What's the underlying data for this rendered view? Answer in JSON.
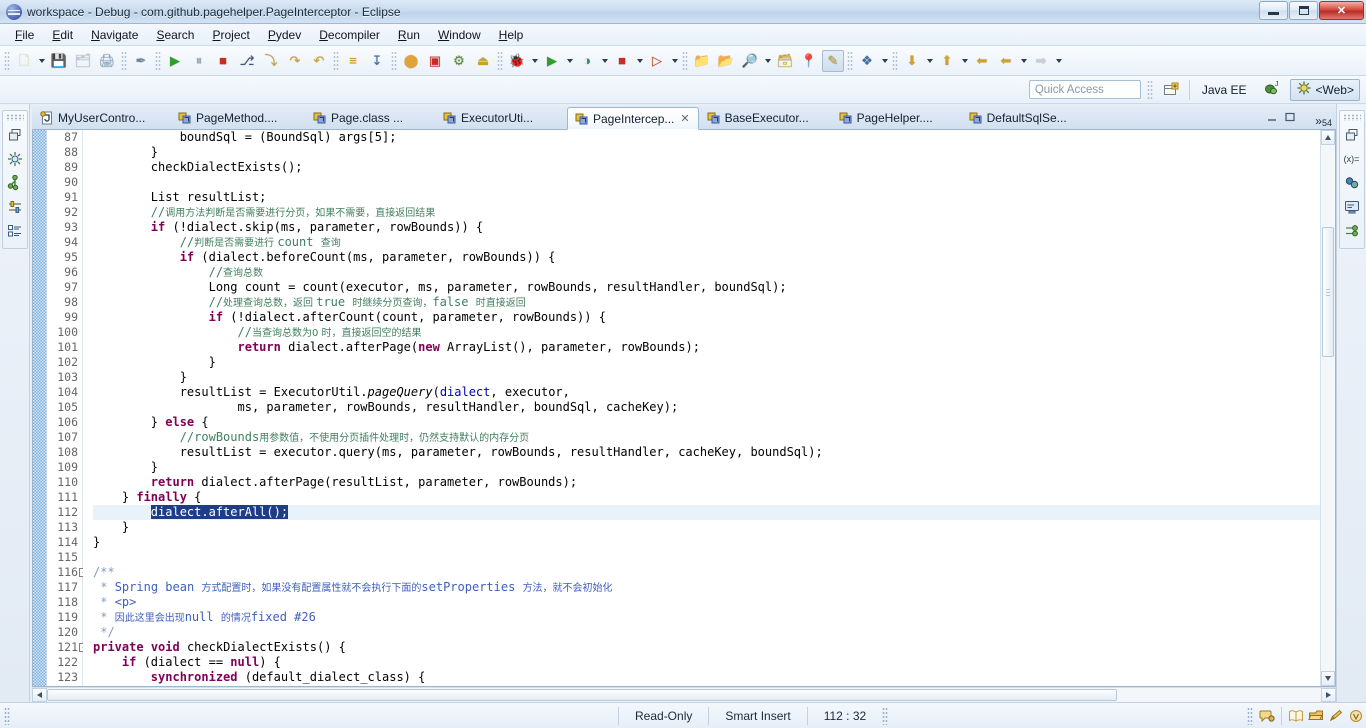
{
  "window": {
    "title": "workspace - Debug - com.github.pagehelper.PageInterceptor - Eclipse",
    "app_icon": "eclipse-icon",
    "minimize_label": "–",
    "maximize_label": "❐",
    "close_label": "✕"
  },
  "menu": {
    "items": [
      {
        "label": "File"
      },
      {
        "label": "Edit"
      },
      {
        "label": "Navigate"
      },
      {
        "label": "Search"
      },
      {
        "label": "Project"
      },
      {
        "label": "Pydev"
      },
      {
        "label": "Decompiler"
      },
      {
        "label": "Run"
      },
      {
        "label": "Window"
      },
      {
        "label": "Help"
      }
    ]
  },
  "toolbar": {
    "groups": [
      {
        "buttons": [
          {
            "name": "new-wizard-icon",
            "glyph": "🗋",
            "dropdown": true,
            "color": "#f5e9a0"
          },
          {
            "name": "save-icon",
            "glyph": "💾",
            "dropdown": false,
            "color": "#b9c7d6"
          },
          {
            "name": "save-all-icon",
            "glyph": "🗂",
            "dropdown": false,
            "color": "#b9c7d6"
          },
          {
            "name": "print-icon",
            "glyph": "🖨",
            "dropdown": false,
            "color": "#7f9fc0"
          }
        ]
      },
      {
        "buttons": [
          {
            "name": "toggle-mark-occurrences-icon",
            "glyph": "✒",
            "dropdown": false,
            "color": "#6f8296"
          }
        ]
      },
      {
        "buttons": [
          {
            "name": "resume-icon",
            "glyph": "▶",
            "dropdown": false,
            "color": "#2f9e2f"
          },
          {
            "name": "suspend-icon",
            "glyph": "⏸",
            "dropdown": false,
            "color": "#9aa8b6"
          },
          {
            "name": "terminate-icon",
            "glyph": "■",
            "dropdown": false,
            "color": "#cc2a22"
          },
          {
            "name": "disconnect-icon",
            "glyph": "⎇",
            "dropdown": false,
            "color": "#3a5a80"
          },
          {
            "name": "step-into-icon",
            "glyph": "⤵",
            "dropdown": false,
            "color": "#c9a227"
          },
          {
            "name": "step-over-icon",
            "glyph": "↷",
            "dropdown": false,
            "color": "#d1a12a"
          },
          {
            "name": "step-return-icon",
            "glyph": "↶",
            "dropdown": false,
            "color": "#d1a12a"
          }
        ]
      },
      {
        "buttons": [
          {
            "name": "run-to-line-icon",
            "glyph": "≡",
            "dropdown": false,
            "color": "#c9a227"
          },
          {
            "name": "drop-to-frame-icon",
            "glyph": "↧",
            "dropdown": false,
            "color": "#3a6ea5"
          }
        ]
      },
      {
        "buttons": [
          {
            "name": "new-java-class-icon",
            "glyph": "⬤",
            "dropdown": false,
            "color": "#e0a33a"
          },
          {
            "name": "new-annotation-icon",
            "glyph": "▣",
            "dropdown": false,
            "color": "#cc2a22"
          },
          {
            "name": "new-package-icon",
            "glyph": "⚙",
            "dropdown": false,
            "color": "#5f8a3f"
          },
          {
            "name": "open-type-icon",
            "glyph": "⏏",
            "dropdown": false,
            "color": "#c9a227"
          }
        ]
      },
      {
        "buttons": [
          {
            "name": "debug-launch-icon",
            "glyph": "🐞",
            "dropdown": true,
            "color": "#5f8a3f"
          },
          {
            "name": "run-launch-icon",
            "glyph": "▶",
            "dropdown": true,
            "color": "#2f9e2f"
          },
          {
            "name": "coverage-icon",
            "glyph": "◑",
            "dropdown": true,
            "color": "#3a8a5f"
          },
          {
            "name": "stop-icon",
            "glyph": "■",
            "dropdown": true,
            "color": "#cc2a22"
          },
          {
            "name": "run-external-tools-icon",
            "glyph": "▷",
            "dropdown": true,
            "color": "#c9522a"
          }
        ]
      },
      {
        "buttons": [
          {
            "name": "new-package-explorer-icon",
            "glyph": "📁",
            "dropdown": false,
            "color": "#e0b352"
          },
          {
            "name": "open-folder-icon",
            "glyph": "📂",
            "dropdown": false,
            "color": "#e0b352"
          },
          {
            "name": "search-icon",
            "glyph": "🔎",
            "dropdown": true,
            "color": "#d1a12a"
          },
          {
            "name": "open-task-icon",
            "glyph": "🗃",
            "dropdown": false,
            "color": "#d1a12a"
          },
          {
            "name": "pin-icon",
            "glyph": "📍",
            "dropdown": false,
            "color": "#3a8a5f"
          },
          {
            "name": "pen-highlight-icon",
            "glyph": "✎",
            "dropdown": false,
            "color": "#c9a227",
            "pressed": true
          }
        ]
      },
      {
        "buttons": [
          {
            "name": "refactor-icon",
            "glyph": "❖",
            "dropdown": true,
            "color": "#3a6ea5"
          }
        ]
      },
      {
        "buttons": [
          {
            "name": "next-annotation-icon",
            "glyph": "⬇",
            "dropdown": true,
            "color": "#d1a12a"
          },
          {
            "name": "previous-annotation-icon",
            "glyph": "⬆",
            "dropdown": true,
            "color": "#d1a12a"
          },
          {
            "name": "last-edit-location-icon",
            "glyph": "⬅",
            "dropdown": false,
            "color": "#d1a12a"
          },
          {
            "name": "back-icon",
            "glyph": "⬅",
            "dropdown": true,
            "color": "#d1a12a"
          },
          {
            "name": "forward-icon",
            "glyph": "➡",
            "dropdown": true,
            "color": "#c5cfd9"
          }
        ]
      }
    ]
  },
  "perspective_bar": {
    "quick_access_placeholder": "Quick Access",
    "open_perspective_icon": "open-perspective-icon",
    "perspectives": [
      {
        "name": "java-ee-perspective",
        "label": "Java EE",
        "icon": "java-ee-icon",
        "active": false
      },
      {
        "name": "debug-perspective",
        "label": "",
        "icon": "debug-perspective-icon",
        "active": false
      },
      {
        "name": "web-perspective",
        "label": "<Web>",
        "icon": "web-perspective-icon",
        "active": true
      }
    ]
  },
  "left_rail": {
    "icons": [
      {
        "name": "restore-view-icon",
        "glyph": "❐"
      },
      {
        "name": "debug-view-icon",
        "glyph": "✳"
      },
      {
        "name": "breakpoints-view-icon",
        "glyph": "⚯"
      },
      {
        "name": "variables-view-icon",
        "glyph": "⚖"
      },
      {
        "name": "outline-view-icon",
        "glyph": "▦"
      }
    ]
  },
  "right_rail": {
    "icons": [
      {
        "name": "restore-view-icon",
        "glyph": "❐"
      },
      {
        "name": "variables-view-icon",
        "glyph": "(x)="
      },
      {
        "name": "breakpoints-view-icon",
        "glyph": "⚬⚬"
      },
      {
        "name": "console-view-icon",
        "glyph": "▣"
      },
      {
        "name": "outline-view-icon",
        "glyph": "⑂"
      }
    ]
  },
  "editor_tabs": {
    "items": [
      {
        "label": "MyUserContro...",
        "icon": "java-file-icon",
        "active": false,
        "closable": false
      },
      {
        "label": "PageMethod....",
        "icon": "class-file-icon",
        "active": false,
        "closable": false
      },
      {
        "label": "Page.class ...",
        "icon": "class-file-icon",
        "active": false,
        "closable": false
      },
      {
        "label": "ExecutorUti...",
        "icon": "class-file-icon",
        "active": false,
        "closable": false
      },
      {
        "label": "PageIntercep...",
        "icon": "class-file-icon",
        "active": true,
        "closable": true
      },
      {
        "label": "BaseExecutor...",
        "icon": "class-file-icon",
        "active": false,
        "closable": false
      },
      {
        "label": "PageHelper....",
        "icon": "class-file-icon",
        "active": false,
        "closable": false
      },
      {
        "label": "DefaultSqlSe...",
        "icon": "class-file-icon",
        "active": false,
        "closable": false
      }
    ],
    "overflow_glyph": "»",
    "overflow_count": "54",
    "minimize_icon": "minimize-icon",
    "maximize_icon": "maximize-icon"
  },
  "editor": {
    "first_line": 87,
    "current_line": 112,
    "lines": [
      {
        "n": 87,
        "fold": "",
        "html": "            boundSql = (BoundSql) args[5];"
      },
      {
        "n": 88,
        "fold": "",
        "html": "        }"
      },
      {
        "n": 89,
        "fold": "",
        "html": "        checkDialectExists();"
      },
      {
        "n": 90,
        "fold": "",
        "html": ""
      },
      {
        "n": 91,
        "fold": "",
        "html": "        List resultList;"
      },
      {
        "n": 92,
        "fold": "",
        "html": "        <span class=\"cm\">//</span><span class=\"cmz\">调用方法判断是否需要进行分页，如果不需要，直接返回结果</span>"
      },
      {
        "n": 93,
        "fold": "",
        "html": "        <span class=\"kw\">if</span> (!dialect.skip(ms, parameter, rowBounds)) {"
      },
      {
        "n": 94,
        "fold": "",
        "html": "            <span class=\"cm\">//</span><span class=\"cmz\">判断是否需要进行 </span><span class=\"cm\">count </span><span class=\"cmz\">查询</span>"
      },
      {
        "n": 95,
        "fold": "",
        "html": "            <span class=\"kw\">if</span> (dialect.beforeCount(ms, parameter, rowBounds)) {"
      },
      {
        "n": 96,
        "fold": "",
        "html": "                <span class=\"cm\">//</span><span class=\"cmz\">查询总数</span>"
      },
      {
        "n": 97,
        "fold": "",
        "html": "                Long count = count(executor, ms, parameter, rowBounds, resultHandler, boundSql);"
      },
      {
        "n": 98,
        "fold": "",
        "html": "                <span class=\"cm\">//</span><span class=\"cmz\">处理查询总数，返回 </span><span class=\"cm\">true </span><span class=\"cmz\">时继续分页查询，</span><span class=\"cm\">false </span><span class=\"cmz\">时直接返回</span>"
      },
      {
        "n": 99,
        "fold": "",
        "html": "                <span class=\"kw\">if</span> (!dialect.afterCount(count, parameter, rowBounds)) {"
      },
      {
        "n": 100,
        "fold": "",
        "html": "                    <span class=\"cm\">//</span><span class=\"cmz\">当查询总数为0 时，直接返回空的结果</span>"
      },
      {
        "n": 101,
        "fold": "",
        "html": "                    <span class=\"kw\">return</span> dialect.afterPage(<span class=\"kw\">new</span> ArrayList(), parameter, rowBounds);"
      },
      {
        "n": 102,
        "fold": "",
        "html": "                }"
      },
      {
        "n": 103,
        "fold": "",
        "html": "            }"
      },
      {
        "n": 104,
        "fold": "",
        "html": "            resultList = ExecutorUtil.<span class=\"mth\">pageQuery</span>(<span class=\"fld\">dialect</span>, executor,"
      },
      {
        "n": 105,
        "fold": "",
        "html": "                    ms, parameter, rowBounds, resultHandler, boundSql, cacheKey);"
      },
      {
        "n": 106,
        "fold": "",
        "html": "        } <span class=\"kw\">else</span> {"
      },
      {
        "n": 107,
        "fold": "",
        "html": "            <span class=\"cm\">//rowBounds</span><span class=\"cmz\">用参数值，不使用分页插件处理时，仍然支持默认的内存分页</span>"
      },
      {
        "n": 108,
        "fold": "",
        "html": "            resultList = executor.query(ms, parameter, rowBounds, resultHandler, cacheKey, boundSql);"
      },
      {
        "n": 109,
        "fold": "",
        "html": "        }"
      },
      {
        "n": 110,
        "fold": "",
        "html": "        <span class=\"kw\">return</span> dialect.afterPage(resultList, parameter, rowBounds);"
      },
      {
        "n": 111,
        "fold": "",
        "html": "    } <span class=\"kw\">finally</span> {"
      },
      {
        "n": 112,
        "fold": "",
        "html": "        <span class=\"sel\">dialect.afterAll();</span>",
        "current": true
      },
      {
        "n": 113,
        "fold": "",
        "html": "    }"
      },
      {
        "n": 114,
        "fold": "",
        "html": "}"
      },
      {
        "n": 115,
        "fold": "",
        "html": ""
      },
      {
        "n": 116,
        "fold": "-",
        "html": "<span class=\"jdt\">/**</span>"
      },
      {
        "n": 117,
        "fold": "",
        "html": " <span class=\"jdt\">*</span> <span class=\"jd\">Spring bean </span><span class=\"jdz\">方式配置时，如果没有配置属性就不会执行下面的</span><span class=\"jd\">setProperties </span><span class=\"jdz\">方法，就不会初始化</span>"
      },
      {
        "n": 118,
        "fold": "",
        "html": " <span class=\"jdt\">*</span> <span class=\"jd\">&lt;p&gt;</span>"
      },
      {
        "n": 119,
        "fold": "",
        "html": " <span class=\"jdt\">*</span> <span class=\"jdz\">因此这里会出现</span><span class=\"jd\">null </span><span class=\"jdz\">的情况</span><span class=\"jd\">fixed #26</span>"
      },
      {
        "n": 120,
        "fold": "",
        "html": " <span class=\"jdt\">*/</span>"
      },
      {
        "n": 121,
        "fold": "-",
        "html": "<span class=\"kw\">private</span> <span class=\"kw\">void</span> checkDialectExists() {"
      },
      {
        "n": 122,
        "fold": "",
        "html": "    <span class=\"kw\">if</span> (dialect == <span class=\"kw\">null</span>) {"
      },
      {
        "n": 123,
        "fold": "",
        "html": "        <span class=\"kw\">synchronized</span> (default_dialect_class) {"
      }
    ]
  },
  "status_bar": {
    "mode": "Read-Only",
    "insert_mode": "Smart Insert",
    "position": "112 : 32",
    "right_icons": [
      {
        "name": "tip-of-the-day-icon",
        "glyph": "💬",
        "color": "#d9a23a"
      },
      {
        "name": "open-book-icon",
        "glyph": "📖",
        "color": "#e0a85a"
      },
      {
        "name": "bookmark-icon",
        "glyph": "📑",
        "color": "#e09a3a"
      },
      {
        "name": "pencil-icon",
        "glyph": "✏",
        "color": "#e0a23a"
      },
      {
        "name": "shield-icon",
        "glyph": "◎",
        "color": "#d9a23a"
      }
    ]
  }
}
